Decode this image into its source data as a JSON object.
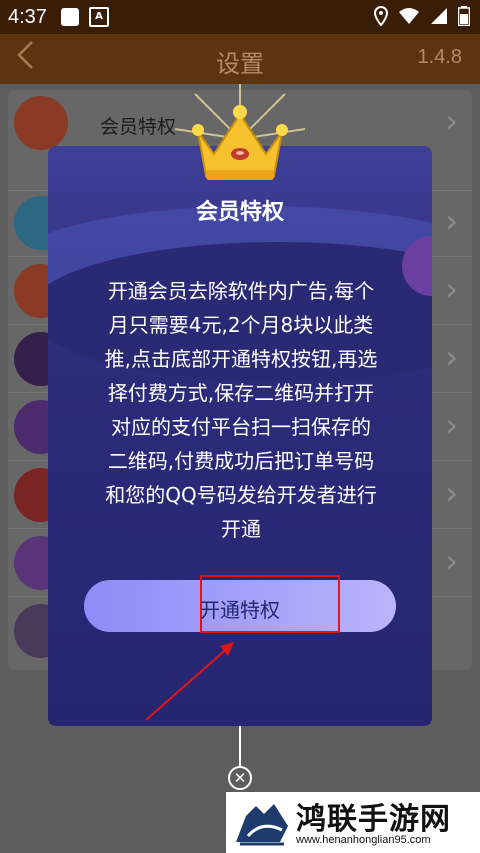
{
  "status_bar": {
    "time": "4:37"
  },
  "header": {
    "back_icon": "chevron-left-icon",
    "title": "设置",
    "version": "1.4.8"
  },
  "list": {
    "items": [
      {
        "label": "会员特权",
        "icon": "soundwave-icon",
        "color": "#8a3a25"
      },
      {
        "label": "",
        "icon": "download-icon",
        "color": "#2e6780"
      },
      {
        "label": "",
        "icon": "chart-icon",
        "color": "#8a3a25"
      },
      {
        "label": "",
        "icon": "ring-icon",
        "color": "#34204a"
      },
      {
        "label": "",
        "icon": "share-icon",
        "color": "#4d2a6b"
      },
      {
        "label": "",
        "icon": "shield-icon",
        "color": "#7a2424"
      },
      {
        "label": "",
        "icon": "music-icon",
        "color": "#5b3478"
      },
      {
        "label": "",
        "icon": "chat-icon",
        "color": "#4a3a5a"
      }
    ]
  },
  "dialog": {
    "title": "会员特权",
    "body_lines": [
      "开通会员去除软件内广告,每个",
      "月只需要4元,2个月8块以此类",
      "推,点击底部开通特权按钮,再选",
      "择付费方式,保存二维码并打开",
      "对应的支付平台扫一扫保存的",
      "二维码,付费成功后把订单号码",
      "和您的QQ号码发给开发者进行",
      "开通"
    ],
    "button_label": "开通特权",
    "crown_icon": "crown-icon",
    "close_icon": "close-icon"
  },
  "watermark": {
    "name": "鸿联手游网",
    "url": "www.henanhonglian95.com"
  },
  "colors": {
    "accent": "#2c2b7a",
    "highlight": "#e01515",
    "button": "#a9a5fa"
  }
}
